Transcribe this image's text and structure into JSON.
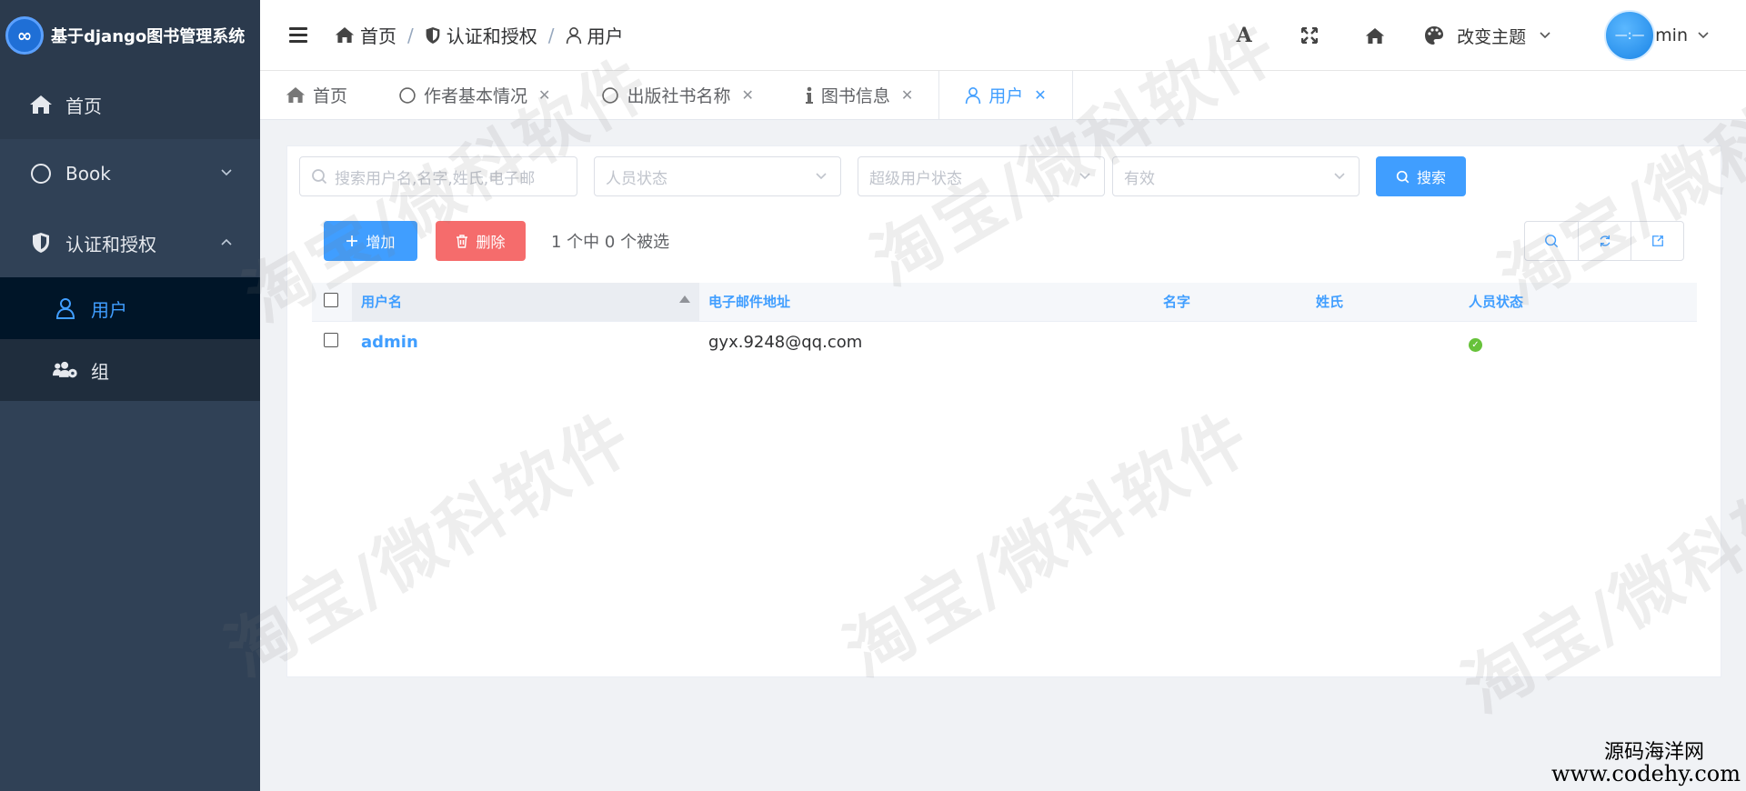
{
  "app": {
    "title": "基于django图书管理系统",
    "logo_glyph": "∞"
  },
  "sidebar": {
    "items": [
      {
        "label": "首页",
        "icon": "home-icon"
      },
      {
        "label": "Book",
        "icon": "circle-icon"
      },
      {
        "label": "认证和授权",
        "icon": "shield-icon"
      }
    ],
    "subitems": [
      {
        "label": "用户",
        "icon": "user-icon",
        "active": true
      },
      {
        "label": "组",
        "icon": "users-gear-icon"
      }
    ]
  },
  "header": {
    "breadcrumb": [
      "首页",
      "认证和授权",
      "用户"
    ],
    "separator": "/",
    "theme_label": "改变主题",
    "user_name": "min",
    "avatar_text": "—:—",
    "font_icon_glyph": "A"
  },
  "tabs": [
    {
      "label": "首页",
      "closable": false
    },
    {
      "label": "作者基本情况",
      "closable": true
    },
    {
      "label": "出版社书名称",
      "closable": true
    },
    {
      "label": "图书信息",
      "closable": true
    },
    {
      "label": "用户",
      "closable": true,
      "active": true
    }
  ],
  "filters": {
    "search_placeholder": "搜索用户名,名字,姓氏,电子邮",
    "status_placeholder": "人员状态",
    "superuser_placeholder": "超级用户状态",
    "active_placeholder": "有效",
    "search_button": "搜索"
  },
  "toolbar": {
    "add_label": "增加",
    "delete_label": "删除",
    "selection_info": "1 个中 0 个被选"
  },
  "table": {
    "columns": [
      "用户名",
      "电子邮件地址",
      "名字",
      "姓氏",
      "人员状态"
    ],
    "rows": [
      {
        "username": "admin",
        "email": "gyx.9248@qq.com",
        "first_name": "",
        "last_name": "",
        "is_staff": true
      }
    ]
  },
  "watermark": {
    "text": "淘宝/微科软件"
  },
  "corner_watermark": {
    "line1": "源码海洋网",
    "line2": "www.codehy.com"
  },
  "colors": {
    "primary": "#409eff",
    "danger": "#f56c6c",
    "sidebar": "#304156",
    "success": "#67c23a"
  }
}
